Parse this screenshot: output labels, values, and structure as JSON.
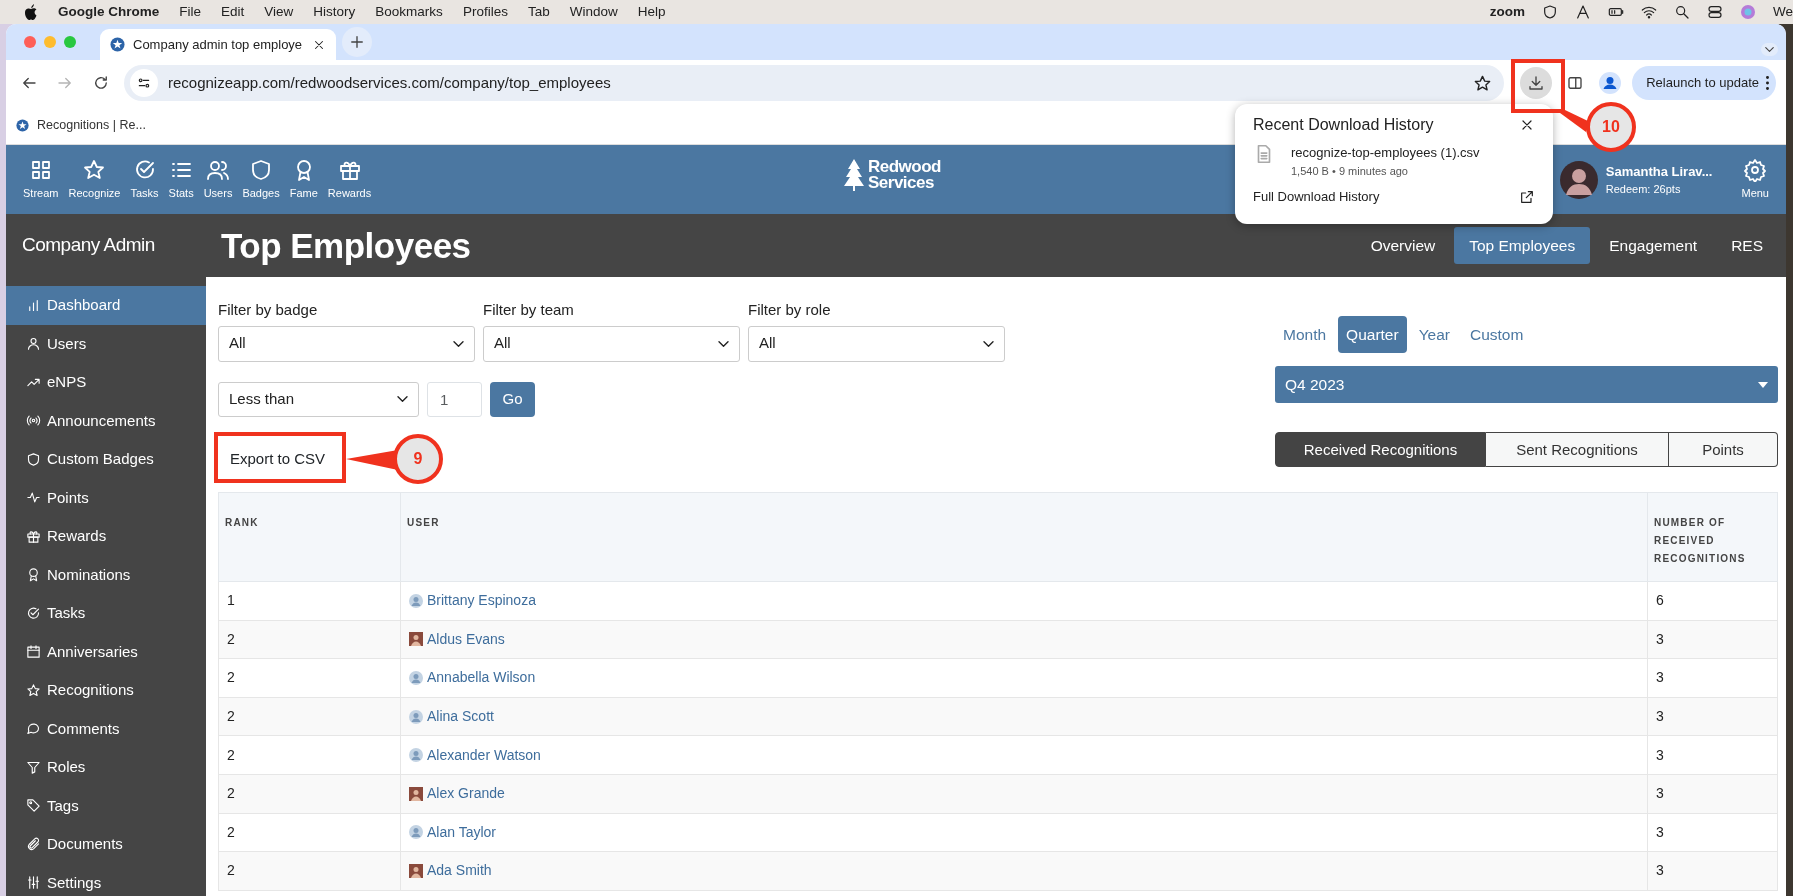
{
  "os_menubar": {
    "app": "Google Chrome",
    "menus": [
      "File",
      "Edit",
      "View",
      "History",
      "Bookmarks",
      "Profiles",
      "Tab",
      "Window",
      "Help"
    ],
    "status_text": "zoom",
    "clock": "We"
  },
  "browser": {
    "tab_title": "Company admin top employe",
    "nav_buttons": [
      {
        "kind": "back",
        "disabled": false
      },
      {
        "kind": "forward",
        "disabled": true
      },
      {
        "kind": "reload",
        "disabled": false
      }
    ],
    "url": "recognizeapp.com/redwoodservices.com/company/top_employees",
    "relaunch": "Relaunch to update",
    "bookmarks": [
      "Recognitions | Re..."
    ]
  },
  "download_popup": {
    "title": "Recent Download History",
    "file": "recognize-top-employees (1).csv",
    "meta": "1,540 B • 9 minutes ago",
    "link": "Full Download History"
  },
  "app_nav": {
    "items": [
      {
        "label": "Stream",
        "kind": "grid"
      },
      {
        "label": "Recognize",
        "kind": "star"
      },
      {
        "label": "Tasks",
        "kind": "check"
      },
      {
        "label": "Stats",
        "kind": "list"
      },
      {
        "label": "Users",
        "kind": "people"
      },
      {
        "label": "Badges",
        "kind": "shield"
      },
      {
        "label": "Fame",
        "kind": "ribbon"
      },
      {
        "label": "Rewards",
        "kind": "gift"
      }
    ],
    "logo": [
      "Redwood",
      "Services"
    ],
    "user_name": "Samantha Lirav...",
    "user_points": "Redeem: 26pts",
    "menu": "Menu"
  },
  "header": {
    "section": "Company Admin",
    "title": "Top Employees",
    "tabs": [
      {
        "label": "Overview",
        "selected": false
      },
      {
        "label": "Top Employees",
        "selected": true
      },
      {
        "label": "Engagement",
        "selected": false
      },
      {
        "label": "RES",
        "selected": false
      }
    ]
  },
  "sidebar": {
    "items": [
      {
        "label": "Dashboard",
        "kind": "bars",
        "selected": true
      },
      {
        "label": "Users",
        "kind": "person",
        "selected": false
      },
      {
        "label": "eNPS",
        "kind": "trend",
        "selected": false
      },
      {
        "label": "Announcements",
        "kind": "broadcast",
        "selected": false
      },
      {
        "label": "Custom Badges",
        "kind": "shield",
        "selected": false
      },
      {
        "label": "Points",
        "kind": "pulse",
        "selected": false
      },
      {
        "label": "Rewards",
        "kind": "gift",
        "selected": false
      },
      {
        "label": "Nominations",
        "kind": "ribbon",
        "selected": false
      },
      {
        "label": "Tasks",
        "kind": "check",
        "selected": false
      },
      {
        "label": "Anniversaries",
        "kind": "calendar",
        "selected": false
      },
      {
        "label": "Recognitions",
        "kind": "star",
        "selected": false
      },
      {
        "label": "Comments",
        "kind": "speech",
        "selected": false
      },
      {
        "label": "Roles",
        "kind": "funnel",
        "selected": false
      },
      {
        "label": "Tags",
        "kind": "tag",
        "selected": false
      },
      {
        "label": "Documents",
        "kind": "clip",
        "selected": false
      },
      {
        "label": "Settings",
        "kind": "sliders",
        "selected": false
      }
    ]
  },
  "filters": [
    {
      "label": "Filter by badge",
      "value": "All"
    },
    {
      "label": "Filter by team",
      "value": "All"
    },
    {
      "label": "Filter by role",
      "value": "All"
    }
  ],
  "threshold": {
    "operator": "Less than",
    "placeholder": "1",
    "button": "Go"
  },
  "export_button": "Export to CSV",
  "period_tabs": [
    {
      "label": "Month",
      "selected": false
    },
    {
      "label": "Quarter",
      "selected": true
    },
    {
      "label": "Year",
      "selected": false
    },
    {
      "label": "Custom",
      "selected": false
    }
  ],
  "period_select": "Q4 2023",
  "metric_tabs": [
    {
      "label": "Received Recognitions",
      "selected": true
    },
    {
      "label": "Sent Recognitions",
      "selected": false
    },
    {
      "label": "Points",
      "selected": false
    }
  ],
  "table": {
    "columns": [
      "RANK",
      "USER",
      "NUMBER OF RECEIVED RECOGNITIONS"
    ],
    "rows": [
      {
        "rank": "1",
        "user": "Brittany Espinoza",
        "kind": "generic",
        "count": "6"
      },
      {
        "rank": "2",
        "user": "Aldus Evans",
        "kind": "photo",
        "count": "3"
      },
      {
        "rank": "2",
        "user": "Annabella Wilson",
        "kind": "generic",
        "count": "3"
      },
      {
        "rank": "2",
        "user": "Alina Scott",
        "kind": "generic",
        "count": "3"
      },
      {
        "rank": "2",
        "user": "Alexander Watson",
        "kind": "generic",
        "count": "3"
      },
      {
        "rank": "2",
        "user": "Alex Grande",
        "kind": "photo",
        "count": "3"
      },
      {
        "rank": "2",
        "user": "Alan Taylor",
        "kind": "generic",
        "count": "3"
      },
      {
        "rank": "2",
        "user": "Ada Smith",
        "kind": "photo",
        "count": "3"
      }
    ]
  },
  "callouts": [
    {
      "number": "9",
      "kind": "export"
    },
    {
      "number": "10",
      "kind": "download"
    }
  ]
}
